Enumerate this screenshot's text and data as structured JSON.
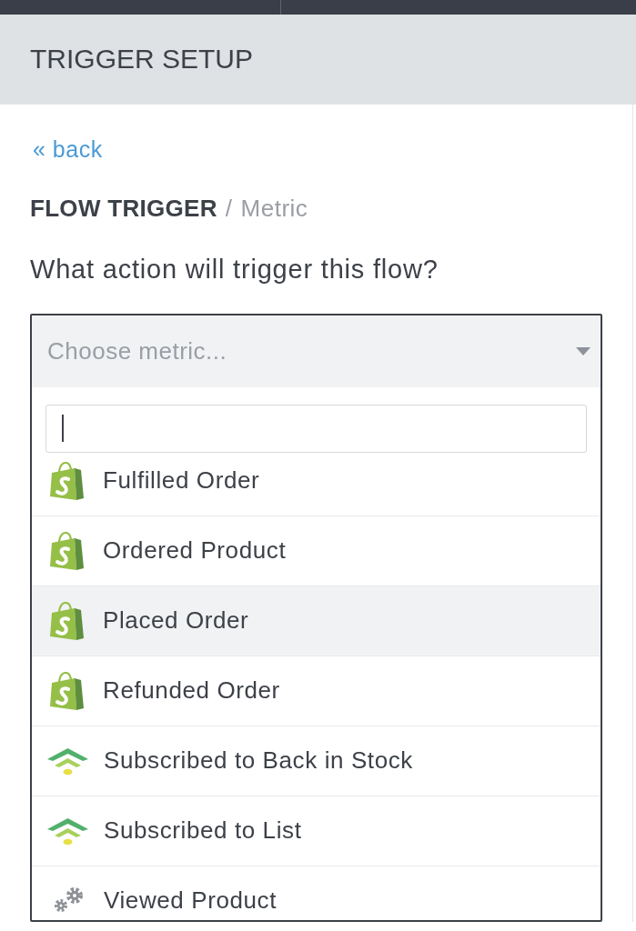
{
  "panel": {
    "title": "TRIGGER SETUP"
  },
  "back_link": {
    "label": "« back"
  },
  "breadcrumb": {
    "section": "FLOW TRIGGER",
    "separator": "/",
    "current": "Metric"
  },
  "question": "What action will trigger this flow?",
  "metric_select": {
    "placeholder": "Choose metric...",
    "expanded": true,
    "search": {
      "focused": true
    },
    "options": [
      {
        "label": "Fulfilled Order",
        "kind": "bag",
        "selected": false
      },
      {
        "label": "Ordered Product",
        "kind": "bag",
        "selected": false
      },
      {
        "label": "Placed Order",
        "kind": "bag",
        "selected": true
      },
      {
        "label": "Refunded Order",
        "kind": "bag",
        "selected": false
      },
      {
        "label": "Subscribed to Back in Stock",
        "kind": "waves",
        "selected": false
      },
      {
        "label": "Subscribed to List",
        "kind": "waves",
        "selected": false
      },
      {
        "label": "Viewed Product",
        "kind": "gears",
        "selected": false
      }
    ]
  }
}
